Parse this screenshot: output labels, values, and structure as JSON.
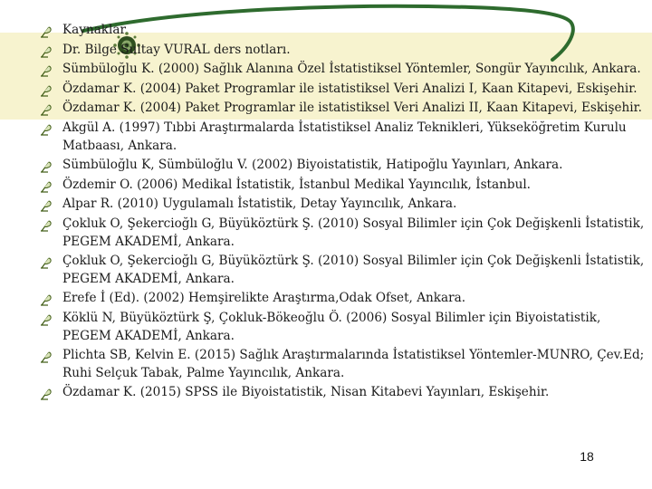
{
  "slide": {
    "colors": {
      "band": "#f7f3cf",
      "arc": "#2e6b2e",
      "bullet": "#3d5a12"
    },
    "bullet_icon": "leaf-pen-icon",
    "references": [
      "Kaynaklar",
      "Dr. Bilge Sultay VURAL ders notları.",
      "Sümbüloğlu K. (2000) Sağlık Alanına Özel İstatistiksel Yöntemler, Songür Yayıncılık, Ankara.",
      "Özdamar K. (2004) Paket Programlar ile istatistiksel Veri Analizi I, Kaan Kitapevi, Eskişehir.",
      "Özdamar K. (2004) Paket Programlar ile istatistiksel Veri Analizi II, Kaan Kitapevi, Eskişehir.",
      "Akgül A. (1997) Tıbbi Araştırmalarda İstatistiksel Analiz Teknikleri, Yükseköğretim Kurulu Matbaası, Ankara.",
      "Sümbüloğlu K, Sümbüloğlu V. (2002) Biyoistatistik, Hatipoğlu Yayınları, Ankara.",
      "Özdemir O. (2006) Medikal İstatistik, İstanbul Medikal Yayıncılık, İstanbul.",
      "Alpar R. (2010) Uygulamalı İstatistik, Detay Yayıncılık, Ankara.",
      "Çokluk O, Şekercioğlı G, Büyüköztürk Ş. (2010) Sosyal Bilimler için Çok Değişkenli İstatistik, PEGEM AKADEMİ, Ankara.",
      "Çokluk O, Şekercioğlı G, Büyüköztürk Ş. (2010) Sosyal Bilimler için Çok Değişkenli İstatistik, PEGEM AKADEMİ, Ankara.",
      "Erefe İ (Ed). (2002) Hemşirelikte Araştırma,Odak Ofset, Ankara.",
      "Köklü N, Büyüköztürk Ş, Çokluk-Bökeoğlu Ö. (2006) Sosyal Bilimler için Biyoistatistik, PEGEM AKADEMİ, Ankara.",
      "Plichta SB, Kelvin E. (2015) Sağlık Araştırmalarında İstatistiksel Yöntemler-MUNRO, Çev.Ed; Ruhi Selçuk Tabak, Palme Yayıncılık, Ankara.",
      "Özdamar K. (2015) SPSS ile Biyoistatistik, Nisan Kitabevi Yayınları, Eskişehir."
    ],
    "page_number": "18"
  }
}
